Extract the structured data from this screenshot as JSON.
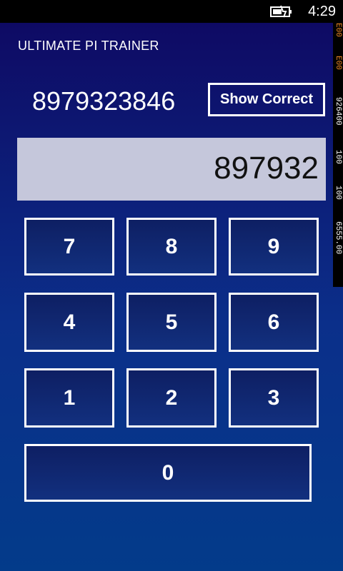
{
  "status": {
    "time": "4:29",
    "icon": "battery-charging-icon"
  },
  "app": {
    "title": "ULTIMATE PI TRAINER"
  },
  "correct": {
    "digits": "8979323846",
    "button_label": "Show Correct"
  },
  "entry": {
    "value": "897932"
  },
  "keypad": {
    "keys": [
      "7",
      "8",
      "9",
      "4",
      "5",
      "6",
      "1",
      "2",
      "3",
      "0"
    ]
  },
  "debug_counters": [
    {
      "text": "E00",
      "color": "#f08a24"
    },
    {
      "text": "E00",
      "color": "#f08a24"
    },
    {
      "text": "926400",
      "color": "#ffffff"
    },
    {
      "text": "100",
      "color": "#ffffff"
    },
    {
      "text": "100",
      "color": "#ffffff"
    },
    {
      "text": "6555.00",
      "color": "#ffffff"
    }
  ]
}
